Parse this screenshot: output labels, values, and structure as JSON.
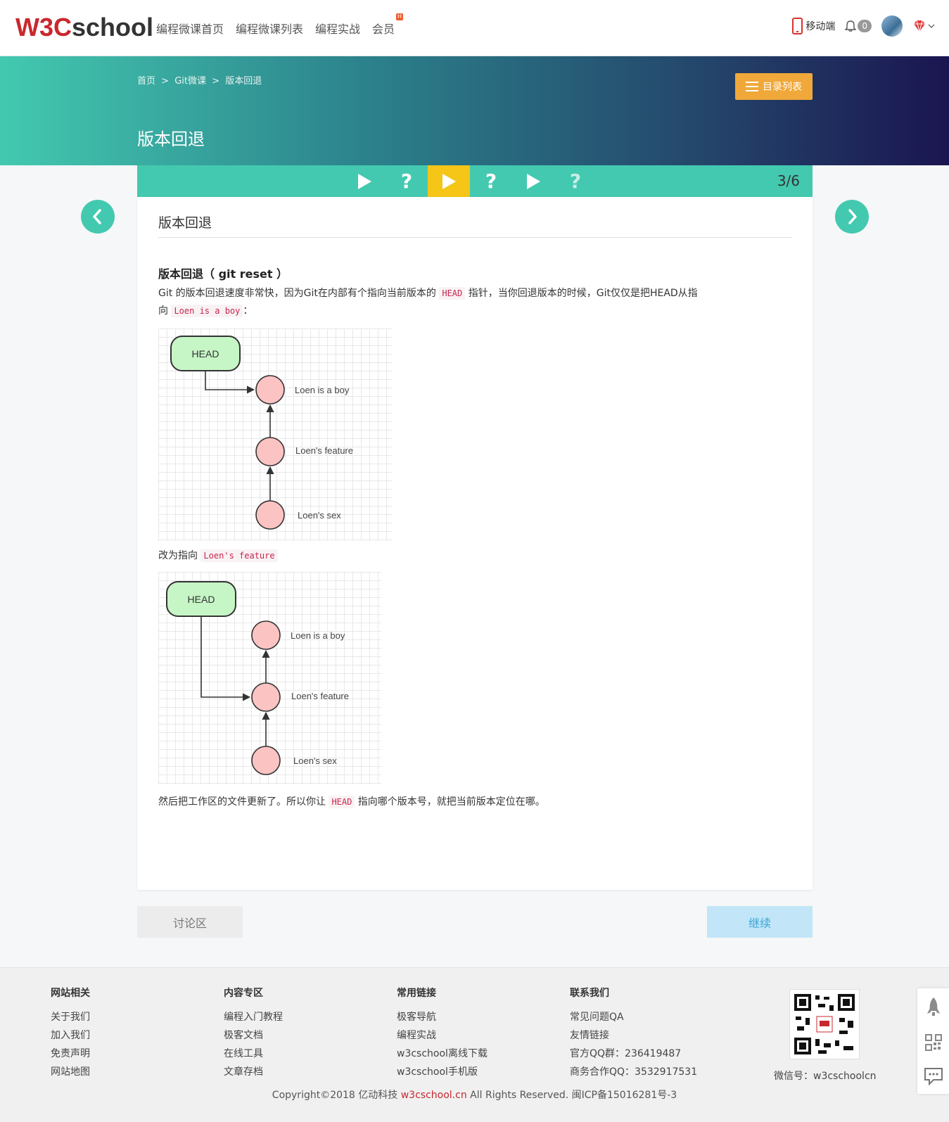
{
  "header": {
    "logo_w3c": "W3C",
    "logo_school": "school",
    "nav": [
      "编程微课首页",
      "编程微课列表",
      "编程实战",
      "会员"
    ],
    "hot_badge": "H",
    "mobile_label": "移动端",
    "notification_count": "0"
  },
  "banner": {
    "breadcrumb": [
      "首页",
      ">",
      "Git微课",
      ">",
      "版本回退"
    ],
    "catalog_button": "目录列表",
    "title": "版本回退"
  },
  "stepbar": {
    "steps": [
      {
        "type": "play",
        "active": false
      },
      {
        "type": "question",
        "active": false
      },
      {
        "type": "play",
        "active": true
      },
      {
        "type": "question",
        "active": false
      },
      {
        "type": "play",
        "active": false
      },
      {
        "type": "question",
        "active": false
      }
    ],
    "question_mark": "?",
    "count": "3/6"
  },
  "content": {
    "title": "版本回退",
    "section_title": "版本回退（ git reset ）",
    "para1_a": "Git 的版本回退速度非常快，因为Git在内部有个指向当前版本的 ",
    "para1_code": "HEAD",
    "para1_b": " 指针，当你回退版本的时候，Git仅仅是把HEAD从指",
    "para1_c": "向 ",
    "para1_code2": "Loen is a boy",
    "para1_d": "：",
    "para2_a": "改为指向 ",
    "para2_code": "Loen's feature",
    "para3_a": "然后把工作区的文件更新了。所以你让 ",
    "para3_code": "HEAD",
    "para3_b": " 指向哪个版本号，就把当前版本定位在哪。",
    "diagram1": {
      "head_label": "HEAD",
      "nodes": [
        "Loen is a boy",
        "Loen's feature",
        "Loen's sex"
      ]
    },
    "diagram2": {
      "head_label": "HEAD",
      "nodes": [
        "Loen is a boy",
        "Loen's feature",
        "Loen's sex"
      ]
    }
  },
  "actions": {
    "discuss": "讨论区",
    "continue": "继续"
  },
  "footer": {
    "columns": [
      {
        "title": "网站相关",
        "links": [
          "关于我们",
          "加入我们",
          "免责声明",
          "网站地图"
        ]
      },
      {
        "title": "内容专区",
        "links": [
          "编程入门教程",
          "极客文档",
          "在线工具",
          "文章存档"
        ]
      },
      {
        "title": "常用链接",
        "links": [
          "极客导航",
          "编程实战",
          "w3cschool离线下载",
          "w3cschool手机版"
        ]
      },
      {
        "title": "联系我们",
        "links": [
          "常见问题QA",
          "友情链接",
          "官方QQ群：236419487",
          "商务合作QQ：3532917531"
        ]
      }
    ],
    "qr_label": "微信号：w3cschoolcn",
    "copyright_a": "Copyright©2018 亿动科技 ",
    "copyright_brand": "w3cschool.cn",
    "copyright_b": " All Rights Reserved. 闽ICP备15016281号-3"
  },
  "colors": {
    "accent": "#43c9b0",
    "active_step": "#f5c518",
    "catalog": "#f0a83a",
    "brand_red": "#c8282e"
  }
}
